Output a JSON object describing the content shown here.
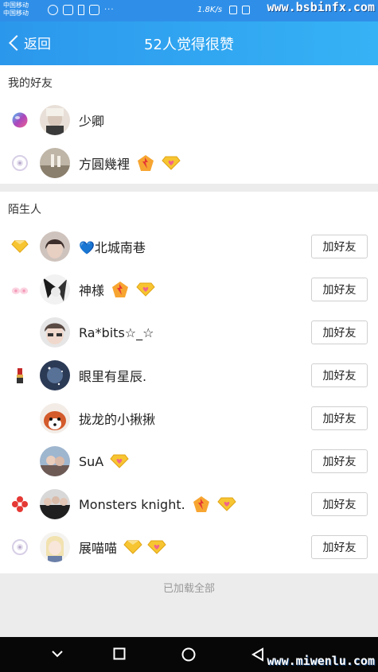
{
  "status_bar": {
    "carrier_lines": [
      "中国移动",
      "中国移动"
    ],
    "net_speed": "1.8K/s",
    "watermark": "www.bsbinfx.com"
  },
  "nav": {
    "back_label": "返回",
    "title": "52人觉得很赞"
  },
  "friends": {
    "header": "我的好友",
    "items": [
      {
        "name": "少卿",
        "lead_icon": "purple-bubble-icon",
        "badges": []
      },
      {
        "name": "方圓幾裡",
        "lead_icon": "eye-ring-icon",
        "badges": [
          "fire-badge-icon",
          "diamond-badge-icon"
        ]
      }
    ]
  },
  "strangers": {
    "header": "陌生人",
    "add_label": "加好友",
    "items": [
      {
        "name": "💙北城南巷",
        "lead_icon": "diamond-badge-icon",
        "badges": []
      },
      {
        "name": "神様",
        "lead_icon": "pink-ears-icon",
        "badges": [
          "fire-badge-icon",
          "diamond-badge-icon"
        ]
      },
      {
        "name": "Ra*bits☆_☆",
        "lead_icon": "",
        "badges": []
      },
      {
        "name": "眼里有星辰.",
        "lead_icon": "lipstick-icon",
        "badges": []
      },
      {
        "name": "拢龙的小揪揪",
        "lead_icon": "",
        "badges": []
      },
      {
        "name": "SuA",
        "lead_icon": "",
        "badges": [
          "diamond-badge-icon"
        ]
      },
      {
        "name": "Monsters knight.",
        "lead_icon": "red-knot-icon",
        "badges": [
          "fire-badge-icon",
          "diamond-badge-icon"
        ]
      },
      {
        "name": "展喵喵",
        "lead_icon": "eye-ring-icon",
        "badges": [
          "diamond-badge-icon",
          "diamond-badge-icon"
        ]
      }
    ]
  },
  "footer": {
    "text": "已加载全部"
  },
  "bottom_watermark": "www.miwenlu.com",
  "colors": {
    "nav_start": "#2b97ec",
    "nav_end": "#36b2f5",
    "badge_gold": "#f7c531",
    "badge_pink": "#f0648c"
  }
}
